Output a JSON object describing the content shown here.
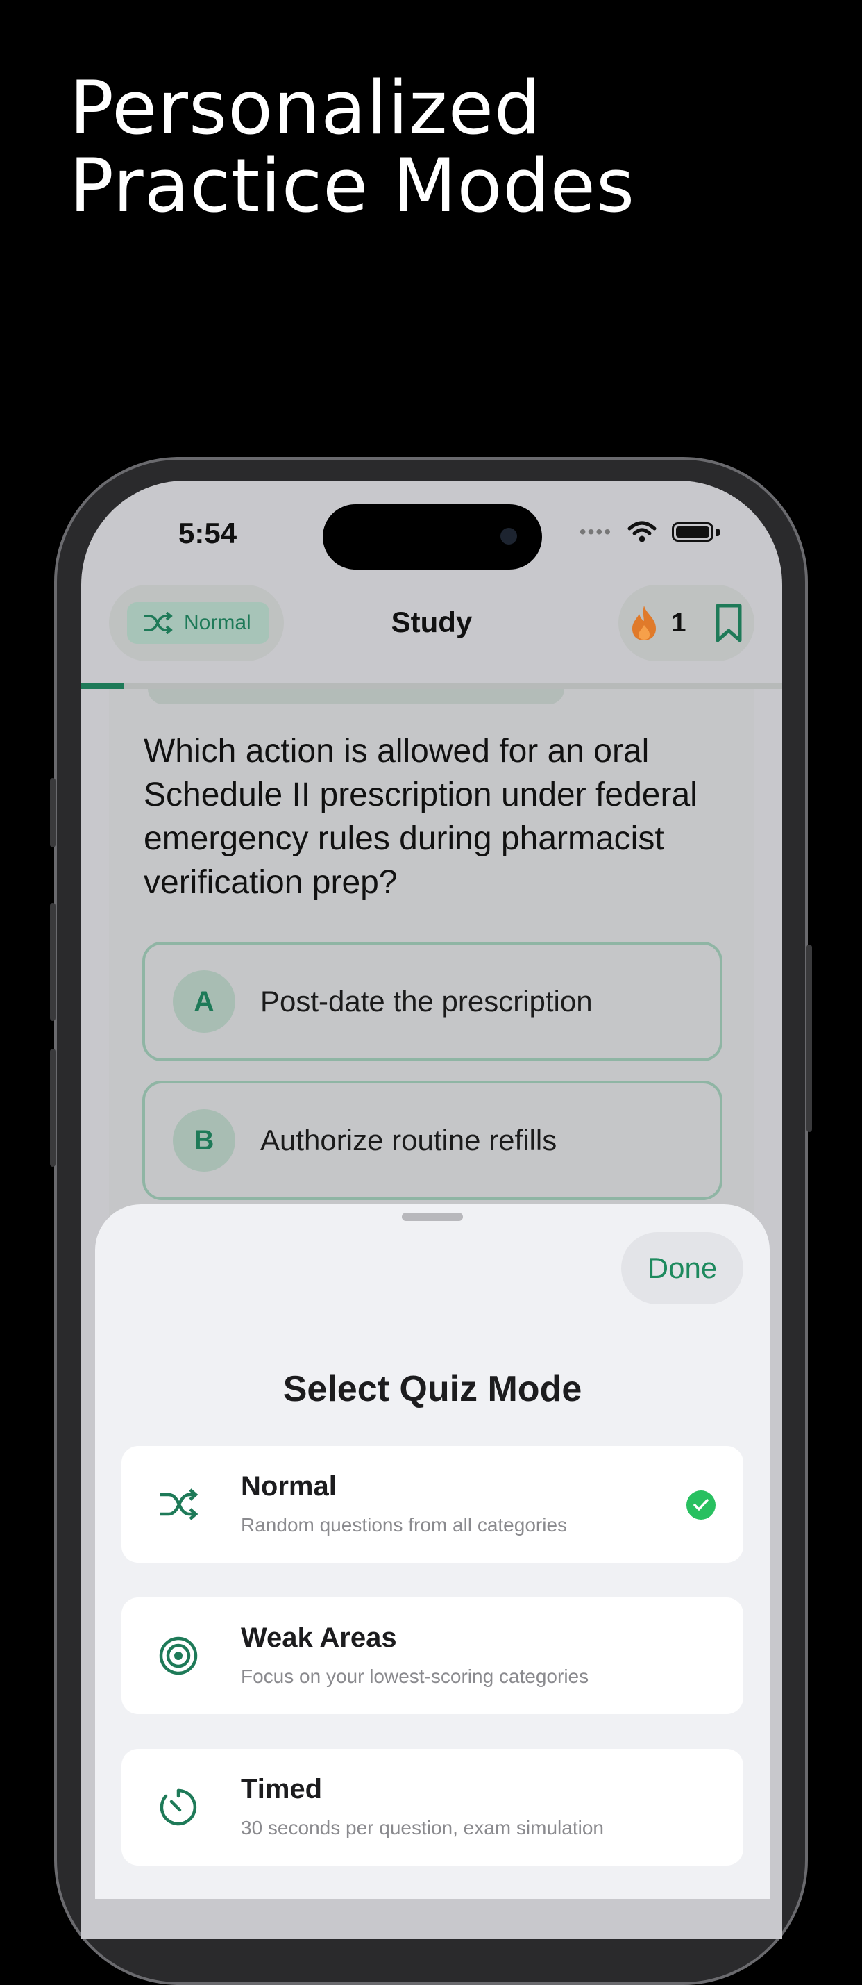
{
  "headline": {
    "line1": "Personalized",
    "line2": "Practice Modes"
  },
  "status_bar": {
    "time": "5:54"
  },
  "nav": {
    "mode_label": "Normal",
    "title": "Study",
    "streak_count": "1"
  },
  "progress": {
    "fraction": 0.06
  },
  "question": {
    "text": "Which action is allowed for an oral Schedule II prescription under federal emergency rules during pharmacist verification prep?",
    "options": [
      {
        "letter": "A",
        "text": "Post-date the prescription"
      },
      {
        "letter": "B",
        "text": "Authorize routine refills"
      }
    ]
  },
  "sheet": {
    "done_label": "Done",
    "title": "Select Quiz Mode",
    "modes": [
      {
        "name": "Normal",
        "desc": "Random questions from all categories",
        "icon": "shuffle-icon",
        "selected": true
      },
      {
        "name": "Weak Areas",
        "desc": "Focus on your lowest-scoring categories",
        "icon": "target-icon",
        "selected": false
      },
      {
        "name": "Timed",
        "desc": "30 seconds per question, exam simulation",
        "icon": "timer-icon",
        "selected": false
      }
    ]
  },
  "colors": {
    "accent": "#1e7a58",
    "check": "#28c060",
    "flame": "#e07a2a"
  }
}
